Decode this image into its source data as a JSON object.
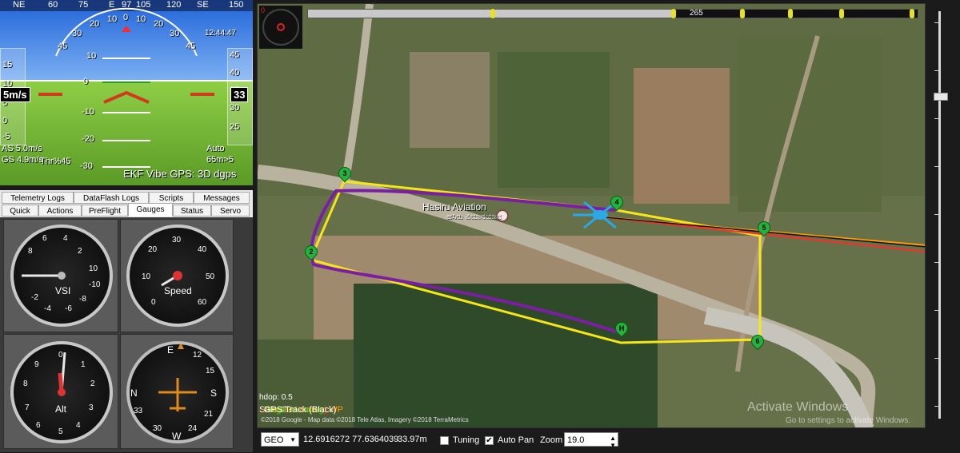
{
  "hud": {
    "compass_labels": [
      "NE",
      "60",
      "75",
      "E",
      "97",
      "105",
      "120",
      "SE",
      "150"
    ],
    "heading": "97",
    "roll_labels": [
      "45",
      "30",
      "20",
      "10",
      "0",
      "10",
      "20",
      "30",
      "45"
    ],
    "pitch_labels": [
      "10",
      "0",
      "-10",
      "-20",
      "-30"
    ],
    "clock": "12:44:47",
    "speed_tape": [
      "15",
      "10",
      "5",
      "0",
      "-5"
    ],
    "alt_tape": [
      "45",
      "40",
      "35",
      "30",
      "25"
    ],
    "vertical_speed_box": "5m/s",
    "altitude_box": "33",
    "airspeed": "AS 5.0m/s",
    "groundspeed": "GS 4.9m/s",
    "throttle": "Thr%45",
    "mode": "Auto",
    "wp_distance": "65m>5",
    "status_line": "EKF Vibe GPS: 3D dgps"
  },
  "tabs": {
    "row1": [
      "Telemetry Logs",
      "DataFlash Logs",
      "Scripts",
      "Messages"
    ],
    "row2": [
      "Quick",
      "Actions",
      "PreFlight",
      "Gauges",
      "Status",
      "Servo"
    ],
    "active": "Gauges"
  },
  "gauges": {
    "vsi": {
      "label": "VSI",
      "numbers": [
        "2",
        "4",
        "6",
        "8",
        "10",
        "-2",
        "-4",
        "-6",
        "-8",
        "-10"
      ]
    },
    "speed": {
      "label": "Speed",
      "numbers": [
        "10",
        "20",
        "30",
        "40",
        "50",
        "60",
        "0"
      ]
    },
    "alt": {
      "label": "Alt",
      "numbers": [
        "0",
        "1",
        "2",
        "3",
        "4",
        "5",
        "6",
        "7",
        "8",
        "9"
      ]
    },
    "heading": {
      "numbers": [
        "E",
        "12",
        "15",
        "S",
        "21",
        "24",
        "W",
        "30",
        "33",
        "N"
      ]
    }
  },
  "map": {
    "progress_value": "265",
    "progress_fraction": 0.6,
    "progress_start": "0",
    "place_name": "Hasiru Aviation",
    "place_name_local": "ಹಸಿರು ವಿಮಾನಯಾನ",
    "waypoints": [
      {
        "id": "2"
      },
      {
        "id": "3"
      },
      {
        "id": "4"
      },
      {
        "id": "5"
      },
      {
        "id": "6"
      },
      {
        "id": "H"
      }
    ],
    "hdop": "hdop: 0.5",
    "sats": "Sats: 22",
    "legend": {
      "current_heading": "Current Heading",
      "direct_wp": "Direct to current WP",
      "target_heading": "Target Heading",
      "gps_track": "GPS Track (Black)"
    },
    "copyright": "©2018 Google - Map data ©2018 Tele Atlas, Imagery ©2018 TerraMetrics",
    "watermark_title": "Activate Windows",
    "watermark_sub": "Go to settings to activate Windows.",
    "colors": {
      "track": "#7b1fa2",
      "route": "#f5e61b",
      "current_heading": "#ff2a2a",
      "target_heading": "#ff9900"
    }
  },
  "bottom": {
    "coord_system": "GEO",
    "coords": "12.6916272 77.6364039",
    "altitude": "33.97m",
    "tuning_label": "Tuning",
    "tuning_checked": false,
    "autopan_label": "Auto Pan",
    "autopan_checked": true,
    "zoom_label": "Zoom",
    "zoom_value": "19.0"
  }
}
